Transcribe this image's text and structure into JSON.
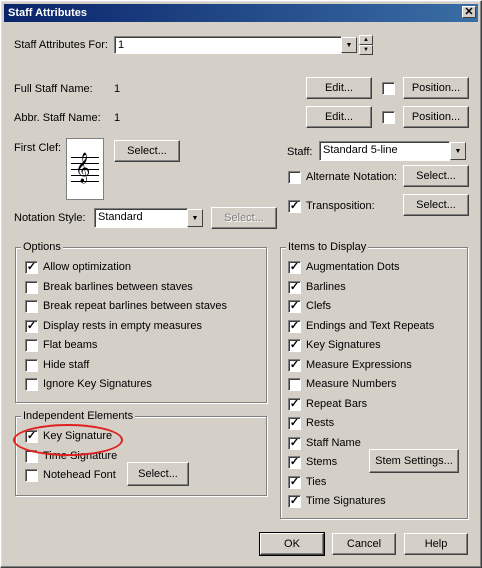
{
  "window": {
    "title": "Staff Attributes",
    "close_icon": "close-icon"
  },
  "staff_for": {
    "label": "Staff Attributes For:",
    "value": "1"
  },
  "full_name": {
    "label": "Full Staff Name:",
    "value": "1",
    "edit": "Edit...",
    "position": "Position..."
  },
  "abbr_name": {
    "label": "Abbr. Staff Name:",
    "value": "1",
    "edit": "Edit...",
    "position": "Position..."
  },
  "first_clef": {
    "label": "First Clef:",
    "select": "Select...",
    "clef_icon": "treble-clef-icon"
  },
  "staff": {
    "label": "Staff:",
    "value": "Standard 5-line"
  },
  "alternate_notation": {
    "label": "Alternate Notation:",
    "checked": false,
    "select": "Select..."
  },
  "transposition": {
    "label": "Transposition:",
    "checked": true,
    "select": "Select..."
  },
  "notation_style": {
    "label": "Notation Style:",
    "value": "Standard",
    "select": "Select..."
  },
  "options": {
    "title": "Options",
    "items": [
      {
        "label": "Allow optimization",
        "checked": true
      },
      {
        "label": "Break barlines between staves",
        "checked": false
      },
      {
        "label": "Break repeat barlines between staves",
        "checked": false
      },
      {
        "label": "Display rests in empty measures",
        "checked": true
      },
      {
        "label": "Flat beams",
        "checked": false
      },
      {
        "label": "Hide staff",
        "checked": false
      },
      {
        "label": "Ignore Key Signatures",
        "checked": false
      }
    ]
  },
  "independent": {
    "title": "Independent Elements",
    "items": [
      {
        "label": "Key Signature",
        "checked": true
      },
      {
        "label": "Time Signature",
        "checked": false
      },
      {
        "label": "Notehead Font",
        "checked": false
      }
    ],
    "select": "Select..."
  },
  "display": {
    "title": "Items to Display",
    "items": [
      {
        "label": "Augmentation Dots",
        "checked": true
      },
      {
        "label": "Barlines",
        "checked": true
      },
      {
        "label": "Clefs",
        "checked": true
      },
      {
        "label": "Endings and Text Repeats",
        "checked": true
      },
      {
        "label": "Key Signatures",
        "checked": true
      },
      {
        "label": "Measure Expressions",
        "checked": true
      },
      {
        "label": "Measure Numbers",
        "checked": false
      },
      {
        "label": "Repeat Bars",
        "checked": true
      },
      {
        "label": "Rests",
        "checked": true
      },
      {
        "label": "Staff Name",
        "checked": true
      },
      {
        "label": "Stems",
        "checked": true
      },
      {
        "label": "Ties",
        "checked": true
      },
      {
        "label": "Time Signatures",
        "checked": true
      }
    ],
    "stem_settings": "Stem Settings..."
  },
  "footer": {
    "ok": "OK",
    "cancel": "Cancel",
    "help": "Help"
  },
  "annotation": {
    "color": "#e02020"
  }
}
